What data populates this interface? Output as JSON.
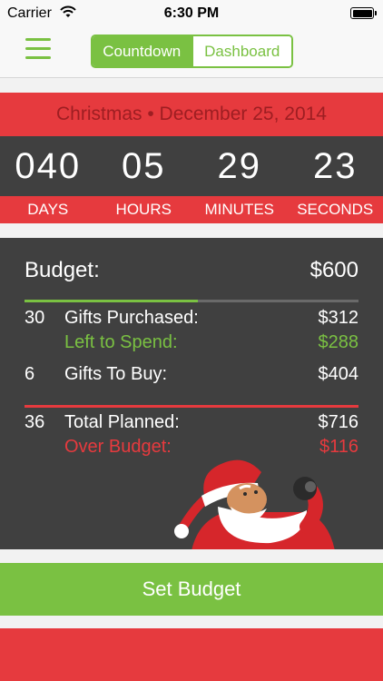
{
  "status_bar": {
    "carrier": "Carrier",
    "time": "6:30 PM",
    "wifi_icon": "wifi-icon",
    "battery_icon": "battery-icon"
  },
  "nav": {
    "menu_icon": "hamburger-menu-icon",
    "tabs": [
      {
        "label": "Countdown",
        "active": true
      },
      {
        "label": "Dashboard",
        "active": false
      }
    ]
  },
  "event": {
    "title": "Christmas • December 25, 2014"
  },
  "countdown": {
    "values": [
      "040",
      "05",
      "29",
      "23"
    ],
    "units": [
      "DAYS",
      "HOURS",
      "MINUTES",
      "SECONDS"
    ]
  },
  "budget": {
    "label": "Budget:",
    "amount": "$600",
    "purchased_progress": 0.52,
    "purchased": {
      "qty": "30",
      "label": "Gifts Purchased:",
      "amount": "$312"
    },
    "left_to_spend": {
      "label": "Left to Spend:",
      "amount": "$288"
    },
    "to_buy": {
      "qty": "6",
      "label": "Gifts To Buy:",
      "amount": "$404"
    },
    "total": {
      "qty": "36",
      "label": "Total Planned:",
      "amount": "$716"
    },
    "over_budget": {
      "label": "Over Budget:",
      "amount": "$116"
    }
  },
  "illustration": "santa-claus-illustration",
  "actions": {
    "set_budget": "Set Budget"
  },
  "colors": {
    "green": "#7ac142",
    "red": "#e63a3e",
    "dark": "#404040"
  }
}
